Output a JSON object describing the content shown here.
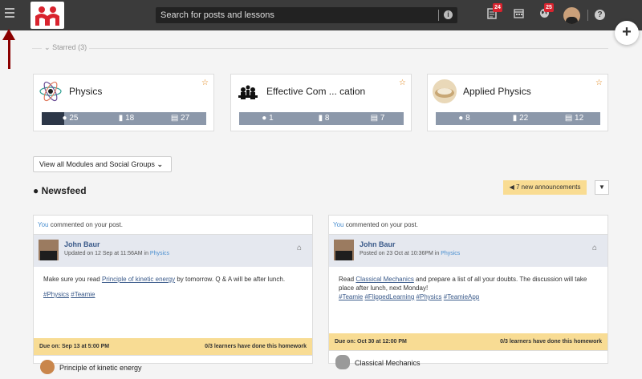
{
  "search": {
    "placeholder": "Search for posts and lessons"
  },
  "topbar": {
    "badge_notes": "24",
    "badge_globe": "25",
    "info_glyph": "i",
    "help_glyph": "?"
  },
  "fab": {
    "label": "+"
  },
  "starred": {
    "label": "Starred (3)"
  },
  "modules": [
    {
      "title": "Physics",
      "stats": {
        "posts": "25",
        "lessons": "18",
        "assignments": "27"
      }
    },
    {
      "title": "Effective Com ... cation",
      "stats": {
        "posts": "1",
        "lessons": "8",
        "assignments": "7"
      }
    },
    {
      "title": "Applied Physics",
      "stats": {
        "posts": "8",
        "lessons": "22",
        "assignments": "12"
      }
    }
  ],
  "view_all": {
    "label": "View all Modules and Social Groups"
  },
  "newsfeed": {
    "title": "Newsfeed",
    "announcements": "7 new announcements"
  },
  "posts": [
    {
      "activity_you": "You",
      "activity_rest": " commented on your post.",
      "author": "John Baur",
      "meta_prefix": "Updated on 12 Sep at 11:56AM",
      "meta_in": " in ",
      "group": "Physics",
      "body_pre": "Make sure you read ",
      "body_link": "Principle of kinetic energy",
      "body_post": "  by tomorrow. Q & A will be after lunch.",
      "tags": [
        "#Physics",
        "#Teamie"
      ],
      "due": "Due on: Sep 13 at 5:00 PM",
      "progress": "0/3 learners have done this homework",
      "resource": "Principle of kinetic energy"
    },
    {
      "activity_you": "You",
      "activity_rest": " commented on your post.",
      "author": "John Baur",
      "meta_prefix": "Posted on 23 Oct at 10:36PM",
      "meta_in": " in ",
      "group": "Physics",
      "body_pre": "Read ",
      "body_link": "Classical Mechanics",
      "body_post": " and prepare a list of all your doubts. The discussion will take place after lunch, next Monday!",
      "tags": [
        "#Teamie",
        "#FlippedLearning",
        "#Physics",
        "#TeamieApp"
      ],
      "due": "Due on: Oct 30 at 12:00 PM",
      "progress": "0/3 learners have done this homework",
      "resource": "Classical Mechanics"
    }
  ],
  "colors": {
    "topbar": "#3b3b3b",
    "accent_link": "#3a5a8a",
    "due_bar": "#f8dc94",
    "badge": "#d9232e",
    "arrow": "#8b0000"
  }
}
